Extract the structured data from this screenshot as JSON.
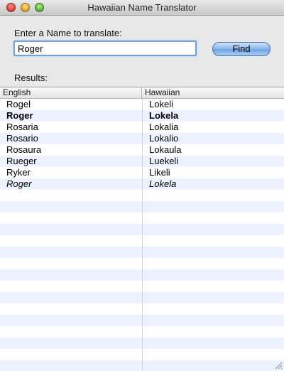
{
  "window": {
    "title": "Hawaiian Name Translator"
  },
  "search": {
    "prompt": "Enter a Name to translate:",
    "value": "Roger",
    "button_label": "Find"
  },
  "results": {
    "label": "Results:",
    "columns": [
      "English",
      "Hawaiian"
    ],
    "rows": [
      {
        "english": "Rogel",
        "hawaiian": "Lokeli",
        "style": "normal"
      },
      {
        "english": "Roger",
        "hawaiian": "Lokela",
        "style": "bold"
      },
      {
        "english": "Rosaria",
        "hawaiian": "Lokalia",
        "style": "normal"
      },
      {
        "english": "Rosario",
        "hawaiian": "Lokalio",
        "style": "normal"
      },
      {
        "english": "Rosaura",
        "hawaiian": "Lokaula",
        "style": "normal"
      },
      {
        "english": "Rueger",
        "hawaiian": "Luekeli",
        "style": "normal"
      },
      {
        "english": "Ryker",
        "hawaiian": "Likeli",
        "style": "normal"
      },
      {
        "english": "Roger",
        "hawaiian": "Lokela",
        "style": "italic"
      }
    ]
  },
  "colors": {
    "stripe": "#edf3fe",
    "focus_ring": "#6fa2dc",
    "button_blue": "#8fbbea"
  },
  "icons": [
    "close-button",
    "minimize-button",
    "zoom-button",
    "resize-grip-icon"
  ]
}
